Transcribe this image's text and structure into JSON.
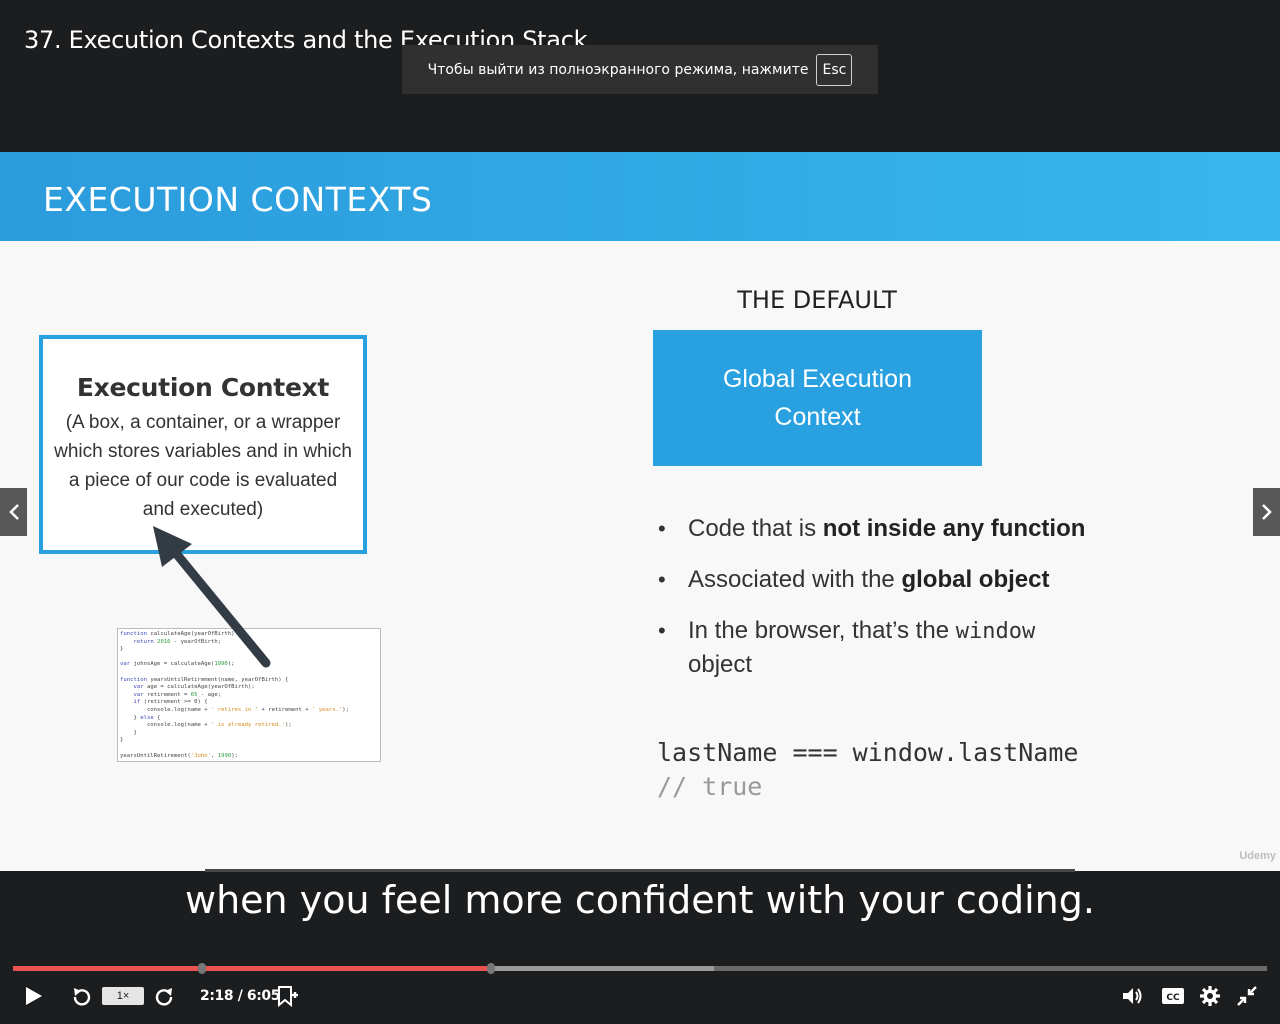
{
  "lecture": {
    "title": "37. Execution Contexts and the Execution Stack"
  },
  "fullscreen_notice": {
    "text": "Чтобы выйти из полноэкранного режима, нажмите",
    "key": "Esc"
  },
  "slide": {
    "header": "EXECUTION CONTEXTS",
    "context_box": {
      "title": "Execution Context",
      "description": "(A box, a container, or a wrapper which stores variables and in which a piece of our code is evaluated and executed)"
    },
    "default_heading": "THE DEFAULT",
    "gec_box": {
      "line1": "Global Execution",
      "line2": "Context"
    },
    "bullets": {
      "b1_pre": "Code that is ",
      "b1_bold": "not inside any function",
      "b2_pre": "Associated with the ",
      "b2_bold": "global object",
      "b3_pre": "In the browser, that’s the ",
      "b3_code": "window",
      "b3_post": "object"
    },
    "code": {
      "line1": "lastName === window.lastName",
      "line2": "// true"
    },
    "watermark": "Udemy",
    "thumbnail_code": [
      "function calculateAge(yearOfBirth) {",
      "    return 2016 - yearOfBirth;",
      "}",
      "",
      "var johnsAge = calculateAge(1990);",
      "",
      "function yearsUntilRetirement(name, yearOfBirth) {",
      "    var age = calculateAge(yearOfBirth);",
      "    var retirement = 65 - age;",
      "    if (retirement >= 0) {",
      "        console.log(name + ' retires in ' + retirement + ' years.');",
      "    } else {",
      "        console.log(name + ' is already retired.');",
      "    }",
      "}",
      "",
      "yearsUntilRetirement('John', 1990);"
    ]
  },
  "caption": "when you feel more confident with your coding.",
  "player": {
    "played_fraction": 0.379,
    "buffered_fraction": 0.559,
    "marker_fractions": [
      0.151,
      0.381
    ],
    "speed": "1×",
    "time": "2:18 / 6:05",
    "accent_color": "#ec5252",
    "icons": [
      "play-icon",
      "rewind-icon",
      "forward-icon",
      "add-note-icon",
      "volume-icon",
      "captions-icon",
      "settings-icon",
      "exit-fullscreen-icon"
    ]
  }
}
